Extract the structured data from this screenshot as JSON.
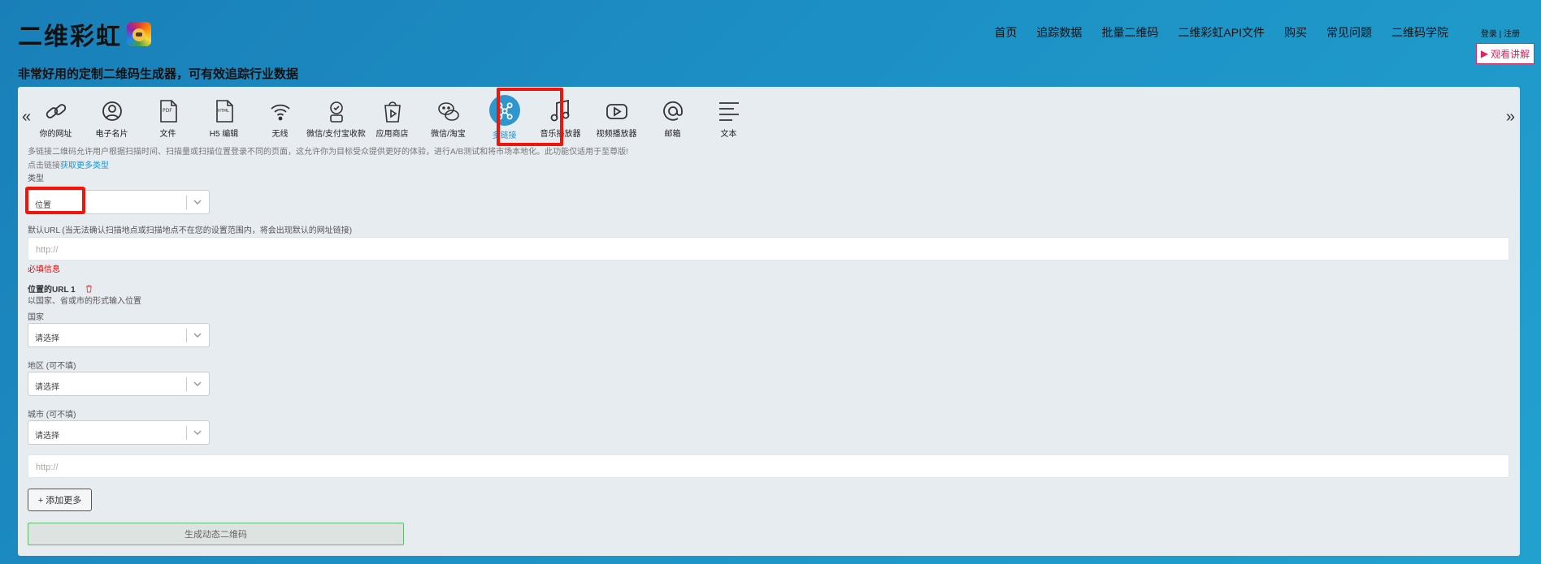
{
  "header": {
    "logo_text": "二维彩虹",
    "logo_icon": "rainbow-bear-icon",
    "nav": [
      "首页",
      "追踪数据",
      "批量二维码",
      "二维彩虹API文件",
      "购买",
      "常见问题",
      "二维码学院"
    ],
    "login": "登录 | 注册",
    "watch_button": "观看讲解",
    "tagline": "非常好用的定制二维码生成器，可有效追踪行业数据"
  },
  "tabs": [
    {
      "label": "你的网址",
      "icon": "link-icon"
    },
    {
      "label": "电子名片",
      "icon": "user-card-icon"
    },
    {
      "label": "文件",
      "icon": "pdf-file-icon"
    },
    {
      "label": "H5 编辑",
      "icon": "html-file-icon"
    },
    {
      "label": "无线",
      "icon": "wifi-icon"
    },
    {
      "label": "微信/支付宝收款",
      "icon": "payment-icon"
    },
    {
      "label": "应用商店",
      "icon": "app-store-icon"
    },
    {
      "label": "微信/淘宝",
      "icon": "wechat-icon"
    },
    {
      "label": "多链接",
      "icon": "multi-link-icon",
      "active": true
    },
    {
      "label": "音乐播放器",
      "icon": "music-icon"
    },
    {
      "label": "视频播放器",
      "icon": "video-play-icon"
    },
    {
      "label": "邮箱",
      "icon": "at-sign-icon"
    },
    {
      "label": "文本",
      "icon": "text-lines-icon"
    }
  ],
  "form": {
    "description": "多链接二维码允许用户根据扫描时间、扫描量或扫描位置登录不同的页面，这允许你为目标受众提供更好的体验，进行A/B测试和将市场本地化。此功能仅适用于至尊版!",
    "more_prefix": "点击链接",
    "more_link": "获取更多类型",
    "type_label": "类型",
    "type_value": "位置",
    "default_url_label": "默认URL (当无法确认扫描地点或扫描地点不在您的设置范围内，将会出现默认的网址链接)",
    "url_placeholder": "http://",
    "required_text": "必填信息",
    "location_title": "位置的URL 1",
    "location_subtitle": "以国家、省或市的形式输入位置",
    "country_label": "国家",
    "region_label": "地区 (可不填)",
    "city_label": "城市 (可不填)",
    "select_placeholder": "请选择",
    "add_more": "+ 添加更多",
    "generate": "生成动态二维码"
  }
}
